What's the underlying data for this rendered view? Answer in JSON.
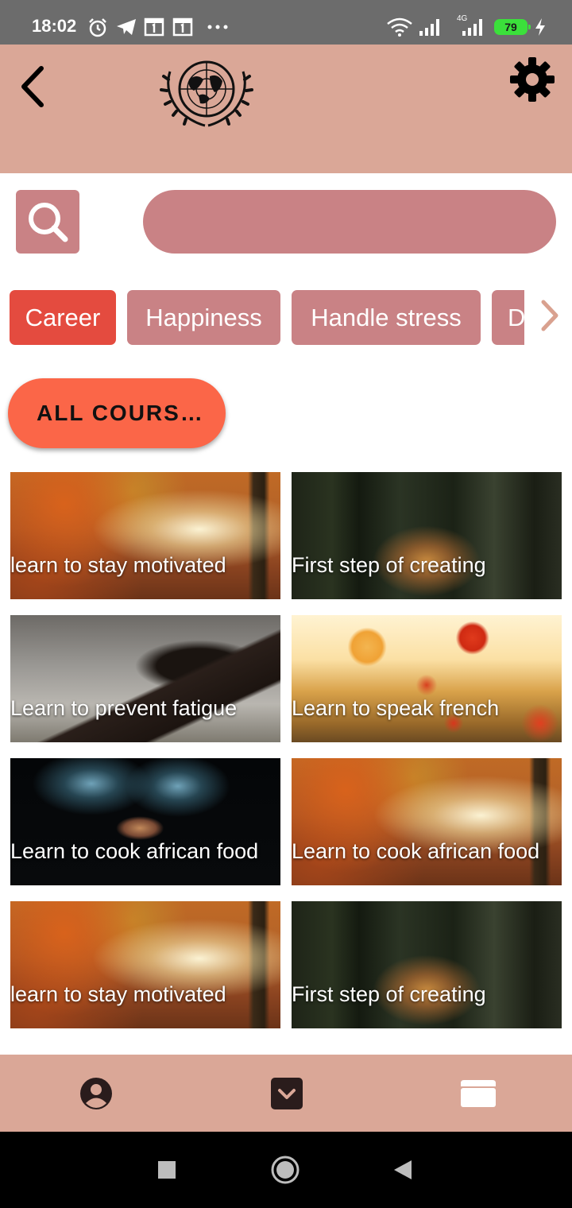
{
  "status_bar": {
    "time": "18:02",
    "battery": "79",
    "network_label": "4G"
  },
  "header": {
    "logo_icon": "un-emblem-icon",
    "back_icon": "chevron-left-icon",
    "settings_icon": "gear-icon"
  },
  "search": {
    "placeholder": "",
    "value": ""
  },
  "categories": [
    {
      "label": "Career",
      "active": true
    },
    {
      "label": "Happiness",
      "active": false
    },
    {
      "label": "Handle stress",
      "active": false
    },
    {
      "label": "D",
      "active": false
    }
  ],
  "all_courses": {
    "label": "ALL COURS…"
  },
  "courses": [
    {
      "title": "learn to stay motivated",
      "image": "autumn-forest"
    },
    {
      "title": "First step of creating",
      "image": "tiger-in-forest"
    },
    {
      "title": "Learn to prevent fatigue",
      "image": "horse-jumping"
    },
    {
      "title": "Learn to speak french",
      "image": "poppy-field"
    },
    {
      "title": "Learn to cook african food",
      "image": "glass-figure-dark"
    },
    {
      "title": "Learn to cook african food",
      "image": "autumn-forest"
    },
    {
      "title": "learn to stay motivated",
      "image": "autumn-forest"
    },
    {
      "title": "First step of creating",
      "image": "tiger-in-forest"
    }
  ],
  "bottom_nav": [
    {
      "icon": "profile-icon"
    },
    {
      "icon": "download-icon"
    },
    {
      "icon": "folder-icon"
    }
  ],
  "colors": {
    "header_bg": "#daa797",
    "chip_active": "#e44b3f",
    "chip_inactive": "#c98285",
    "all_courses_bg": "#fb6648"
  }
}
